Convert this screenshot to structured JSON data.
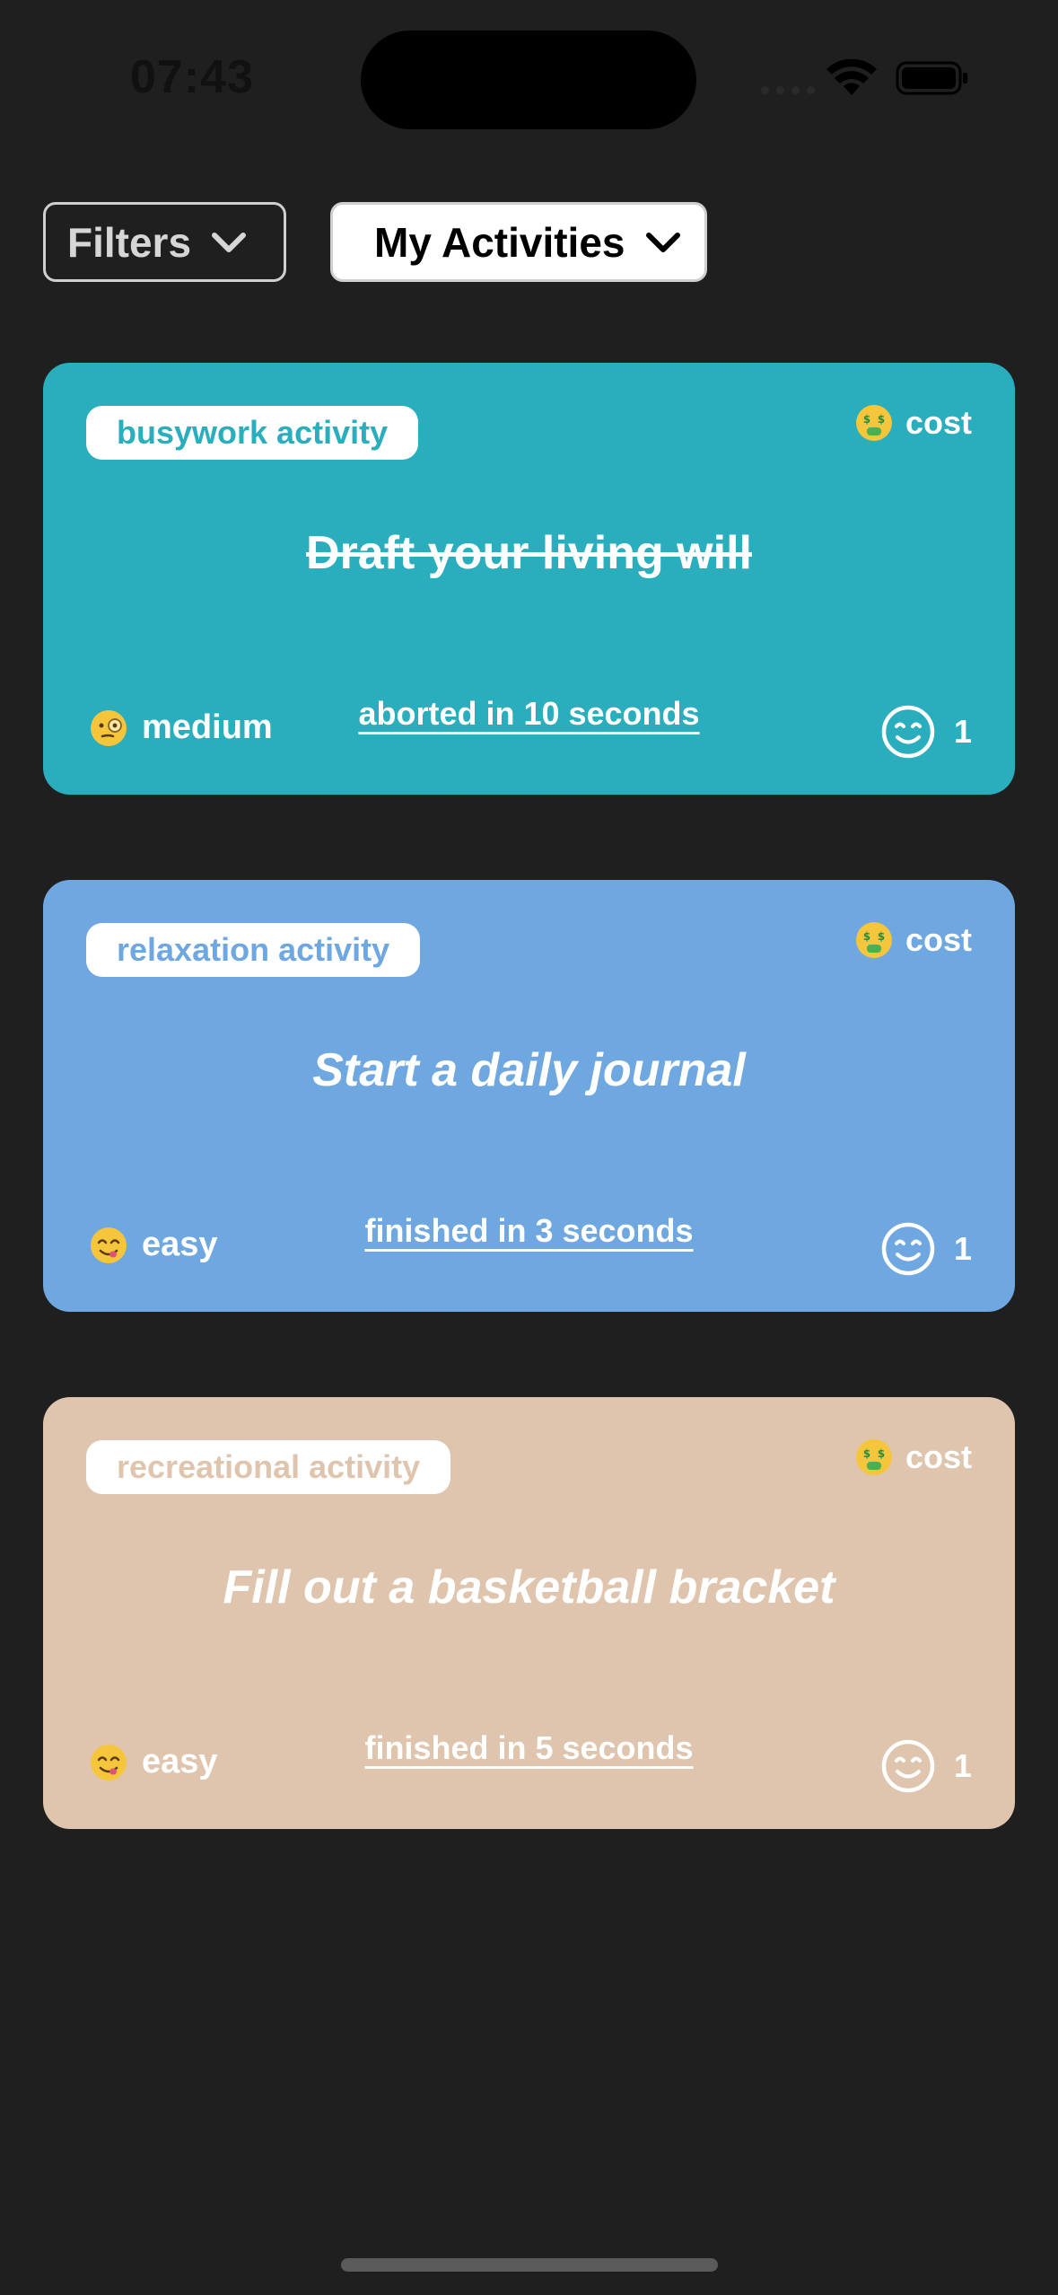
{
  "status_bar": {
    "time": "07:43",
    "icons": [
      "cellular-icon",
      "wifi-icon",
      "battery-icon"
    ]
  },
  "toolbar": {
    "filters_label": "Filters",
    "activities_label": "My Activities"
  },
  "cards": [
    {
      "type_label": "busywork activity",
      "cost_label": "cost",
      "title": "Draft your living will",
      "status": "aborted in 10 seconds",
      "difficulty": "medium",
      "difficulty_emoji": "monocle-face-emoji",
      "rating": "1",
      "color": "#2aaebe"
    },
    {
      "type_label": "relaxation activity",
      "cost_label": "cost",
      "title": "Start a daily journal",
      "status": "finished in 3 seconds",
      "difficulty": "easy",
      "difficulty_emoji": "yum-face-emoji",
      "rating": "1",
      "color": "#6fa8e1"
    },
    {
      "type_label": "recreational activity",
      "cost_label": "cost",
      "title": "Fill out a basketball bracket",
      "status": "finished in 5 seconds",
      "difficulty": "easy",
      "difficulty_emoji": "yum-face-emoji",
      "rating": "1",
      "color": "#dfc5ae"
    }
  ]
}
